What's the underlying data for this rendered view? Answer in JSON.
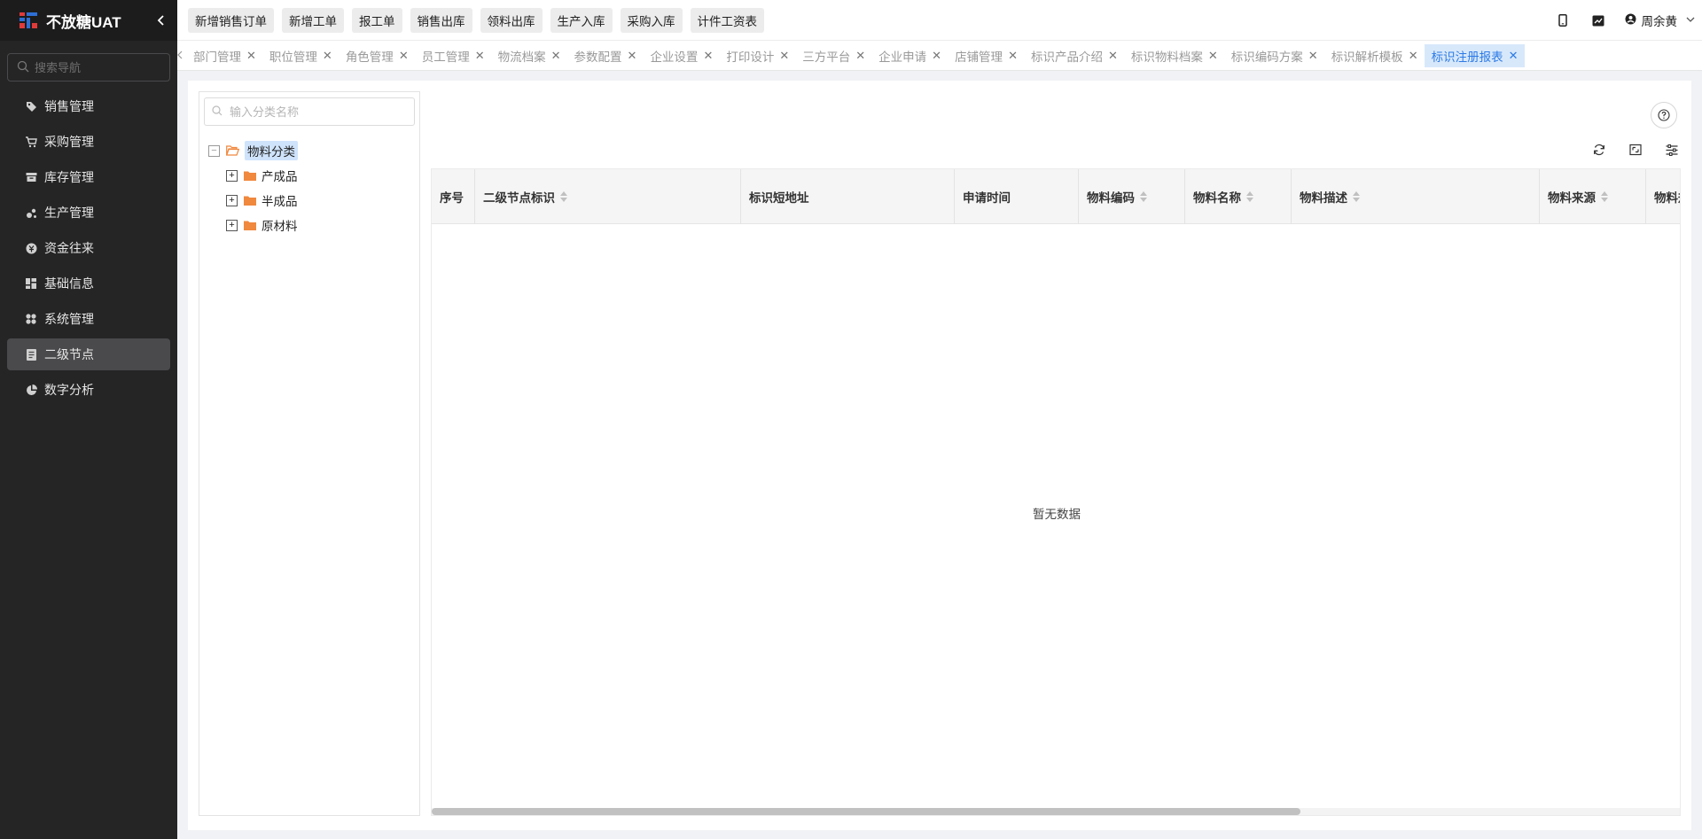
{
  "app": {
    "title": "不放糖UAT",
    "collapse_icon": "chevron-left-icon"
  },
  "sidebar": {
    "search_placeholder": "搜索导航",
    "items": [
      {
        "label": "销售管理",
        "icon": "tag-icon",
        "active": false
      },
      {
        "label": "采购管理",
        "icon": "cart-icon",
        "active": false
      },
      {
        "label": "库存管理",
        "icon": "inventory-icon",
        "active": false
      },
      {
        "label": "生产管理",
        "icon": "production-icon",
        "active": false
      },
      {
        "label": "资金往来",
        "icon": "money-icon",
        "active": false
      },
      {
        "label": "基础信息",
        "icon": "grid-icon",
        "active": false
      },
      {
        "label": "系统管理",
        "icon": "apps-icon",
        "active": false
      },
      {
        "label": "二级节点",
        "icon": "document-icon",
        "active": true
      },
      {
        "label": "数字分析",
        "icon": "pie-chart-icon",
        "active": false
      }
    ]
  },
  "topbar": {
    "quick_buttons": [
      "新增销售订单",
      "新增工单",
      "报工单",
      "销售出库",
      "领料出库",
      "生产入库",
      "采购入库",
      "计件工资表"
    ],
    "user_name": "周余黄"
  },
  "tabs": [
    {
      "label": "部门管理",
      "active": false
    },
    {
      "label": "职位管理",
      "active": false
    },
    {
      "label": "角色管理",
      "active": false
    },
    {
      "label": "员工管理",
      "active": false
    },
    {
      "label": "物流档案",
      "active": false
    },
    {
      "label": "参数配置",
      "active": false
    },
    {
      "label": "企业设置",
      "active": false
    },
    {
      "label": "打印设计",
      "active": false
    },
    {
      "label": "三方平台",
      "active": false
    },
    {
      "label": "企业申请",
      "active": false
    },
    {
      "label": "店铺管理",
      "active": false
    },
    {
      "label": "标识产品介绍",
      "active": false
    },
    {
      "label": "标识物料档案",
      "active": false
    },
    {
      "label": "标识编码方案",
      "active": false
    },
    {
      "label": "标识解析模板",
      "active": false
    },
    {
      "label": "标识注册报表",
      "active": true
    }
  ],
  "tree": {
    "search_placeholder": "输入分类名称",
    "root": {
      "label": "物料分类",
      "expanded": true,
      "selected": true
    },
    "children": [
      {
        "label": "产成品"
      },
      {
        "label": "半成品"
      },
      {
        "label": "原材料"
      }
    ]
  },
  "table": {
    "columns": [
      {
        "label": "序号",
        "sortable": false
      },
      {
        "label": "二级节点标识",
        "sortable": true
      },
      {
        "label": "标识短地址",
        "sortable": false
      },
      {
        "label": "申请时间",
        "sortable": false
      },
      {
        "label": "物料编码",
        "sortable": true
      },
      {
        "label": "物料名称",
        "sortable": true
      },
      {
        "label": "物料描述",
        "sortable": true
      },
      {
        "label": "物料来源",
        "sortable": true
      },
      {
        "label": "物料规格",
        "sortable": true
      }
    ],
    "rows": [],
    "empty_text": "暂无数据"
  },
  "colors": {
    "sidebar_bg": "#252526",
    "active_tab_bg": "#d8e8fb",
    "active_tab_text": "#2d7be5",
    "folder": "#f0883e"
  }
}
